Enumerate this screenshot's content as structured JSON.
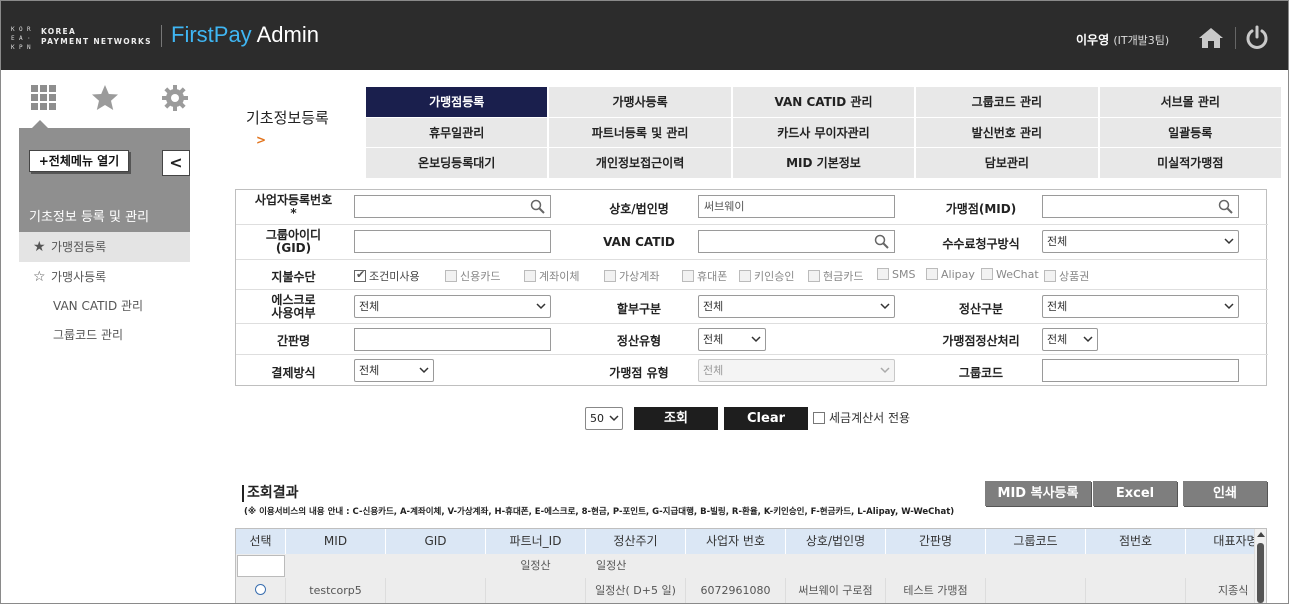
{
  "header": {
    "logo_grid": [
      "K",
      "O",
      "R",
      "E",
      "A",
      "·",
      "K",
      "P",
      "N"
    ],
    "logo_line1": "KOREA",
    "logo_line2": "PAYMENT NETWORKS",
    "app_first": "FirstPay",
    "app_second": " Admin",
    "user_name": "이우영",
    "user_team": "(IT개발3팀)",
    "icons": {
      "home": "home-icon",
      "power": "power-icon"
    },
    "brand_color": "#3fb6f3"
  },
  "sidebar": {
    "tab_icons": [
      "grid-icon",
      "star-icon",
      "gear-icon"
    ],
    "open_all_label": "+전체메뉴 열기",
    "collapse_glyph": "<",
    "section_title": "기초정보 등록 및 관리",
    "items": [
      {
        "label": "가맹점등록",
        "icon": "★",
        "active": true
      },
      {
        "label": "가맹사등록",
        "icon": "☆",
        "active": false
      },
      {
        "label": "VAN CATID 관리",
        "icon": "",
        "active": false
      },
      {
        "label": "그룹코드 관리",
        "icon": "",
        "active": false
      }
    ]
  },
  "breadcrumb": {
    "arrow": ">",
    "label": "기초정보등록"
  },
  "tabs": [
    {
      "label": "가맹점등록",
      "active": true
    },
    {
      "label": "가맹사등록"
    },
    {
      "label": "VAN CATID 관리"
    },
    {
      "label": "그룹코드 관리"
    },
    {
      "label": "서브몰 관리"
    },
    {
      "label": "휴무일관리"
    },
    {
      "label": "파트너등록 및 관리"
    },
    {
      "label": "카드사 무이자관리"
    },
    {
      "label": "발신번호 관리"
    },
    {
      "label": "일괄등록"
    },
    {
      "label": "온보딩등록대기"
    },
    {
      "label": "개인정보접근이력"
    },
    {
      "label": "MID 기본정보"
    },
    {
      "label": "담보관리"
    },
    {
      "label": "미실적가맹점"
    }
  ],
  "form": {
    "biz_no": {
      "label": "사업자등록번호",
      "required": "*",
      "value": ""
    },
    "company": {
      "label": "상호/법인명",
      "value": "써브웨이"
    },
    "mid": {
      "label": "가맹점(MID)",
      "value": ""
    },
    "group_id": {
      "label": "그룹아이디\n(GID)",
      "label1": "그룹아이디",
      "label2": "(GID)",
      "value": ""
    },
    "van_catid": {
      "label": "VAN CATID",
      "value": ""
    },
    "fee_method": {
      "label": "수수료청구방식",
      "selected": "전체"
    },
    "pay_method": {
      "label": "지불수단",
      "options": [
        {
          "label": "조건미사용",
          "checked": true
        },
        {
          "label": "신용카드",
          "checked": false
        },
        {
          "label": "계좌이체",
          "checked": false
        },
        {
          "label": "가상계좌",
          "checked": false
        },
        {
          "label": "휴대폰",
          "checked": false
        },
        {
          "label": "키인승인",
          "checked": false
        },
        {
          "label": "현금카드",
          "checked": false
        },
        {
          "label": "SMS",
          "checked": false
        },
        {
          "label": "Alipay",
          "checked": false
        },
        {
          "label": "WeChat",
          "checked": false
        },
        {
          "label": "상품권",
          "checked": false
        }
      ]
    },
    "escrow": {
      "label1": "에스크로",
      "label2": "사용여부",
      "selected": "전체"
    },
    "installment": {
      "label": "할부구분",
      "selected": "전체"
    },
    "settle_type": {
      "label": "정산구분",
      "selected": "전체"
    },
    "short_name": {
      "label": "간판명",
      "value": ""
    },
    "settle_kind": {
      "label": "정산유형",
      "selected": "전체"
    },
    "merchant_settle": {
      "label": "가맹점정산처리",
      "selected": "전체"
    },
    "pay_way": {
      "label": "결제방식",
      "selected": "전체"
    },
    "merchant_type": {
      "label": "가맹점 유형",
      "selected": "전체"
    },
    "group_code": {
      "label": "그룹코드",
      "value": ""
    }
  },
  "actions": {
    "page_size": "50",
    "search_label": "조회",
    "clear_label": "Clear",
    "tax_label": "세금계산서 전용"
  },
  "results": {
    "title": "조회결과",
    "note": "(※ 이용서비스의 내용 안내 : C-신용카드, A-계좌이체, V-가상계좌, H-휴대폰, E-에스크로, 8-현금, P-포인트, G-지급대행, B-빌링, R-환율, K-키인승인, F-현금카드, L-Alipay, W-WeChat)",
    "buttons": {
      "mid_copy": "MID 복사등록",
      "excel": "Excel",
      "print": "인쇄"
    },
    "columns": [
      "선택",
      "MID",
      "GID",
      "파트너_ID",
      "정산주기",
      "사업자 번호",
      "상호/법인명",
      "간판명",
      "그룹코드",
      "점번호",
      "대표자명"
    ],
    "filter_row": {
      "partner": "일정산",
      "cycle": "일정산"
    },
    "rows": [
      {
        "mid": "testcorp5",
        "gid": "",
        "partner": "",
        "cycle": "일정산( D+5 일)",
        "biz": "6072961080",
        "company": "써브웨이 구로점",
        "short": "테스트 가맹점",
        "group": "",
        "branch": "",
        "ceo": "지종식"
      }
    ]
  }
}
